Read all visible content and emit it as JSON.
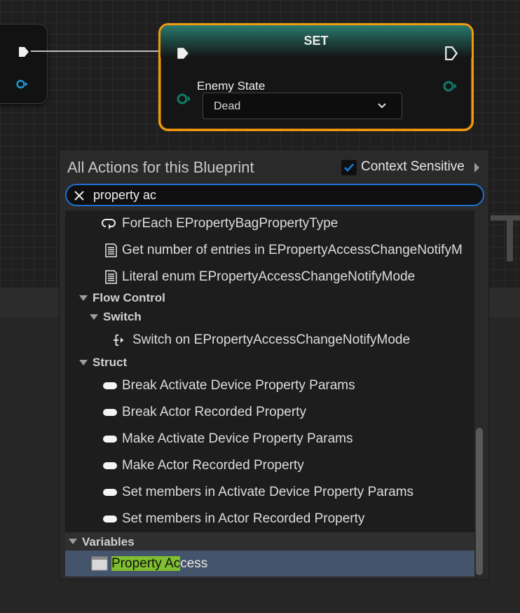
{
  "graph": {
    "set_node": {
      "title": "SET",
      "variable_label": "Enemy State",
      "enum_value": "Dead"
    }
  },
  "menu": {
    "title": "All Actions for this Blueprint",
    "context_sensitive_label": "Context Sensitive",
    "context_sensitive_checked": true,
    "search_value": "property ac",
    "items_top": [
      {
        "label": "ForEach EPropertyBagPropertyType",
        "icon": "loop-icon"
      },
      {
        "label": "Get number of entries in EPropertyAccessChangeNotifyM",
        "icon": "enum-doc-icon"
      },
      {
        "label": "Literal enum EPropertyAccessChangeNotifyMode",
        "icon": "enum-doc-icon"
      }
    ],
    "flow_control": {
      "label": "Flow Control",
      "switch": {
        "label": "Switch",
        "item": "Switch on EPropertyAccessChangeNotifyMode"
      }
    },
    "struct": {
      "label": "Struct",
      "items": [
        "Break Activate Device Property Params",
        "Break Actor Recorded Property",
        "Make Activate Device Property Params",
        "Make Actor Recorded Property",
        "Set members in Activate Device Property Params",
        "Set members in Actor Recorded Property"
      ]
    },
    "variables": {
      "label": "Variables",
      "item_match": "Property Ac",
      "item_rest": "cess"
    }
  },
  "colors": {
    "accent_blue": "#1e6fd0",
    "selection_orange": "#f29a0b",
    "match_green": "#7fbf2f",
    "selected_row": "#44546a"
  }
}
